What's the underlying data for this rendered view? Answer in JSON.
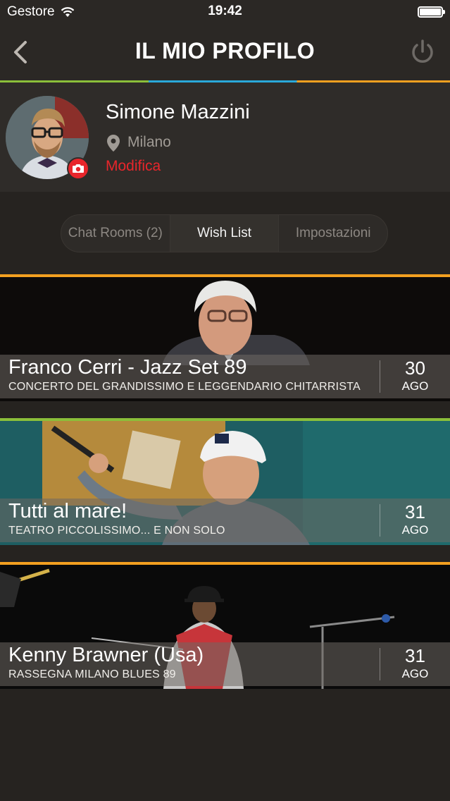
{
  "status_bar": {
    "carrier": "Gestore",
    "time": "19:42",
    "wifi_icon": "wifi-icon",
    "battery_icon": "battery-icon"
  },
  "nav": {
    "title": "IL MIO PROFILO",
    "back_icon": "chevron-left-icon",
    "power_icon": "power-icon",
    "stripe_colors": [
      "#8bbf3a",
      "#2aa9d9",
      "#f3a020"
    ]
  },
  "profile": {
    "name": "Simone Mazzini",
    "city": "Milano",
    "edit_label": "Modifica",
    "accent_color": "#e8262b"
  },
  "tabs": [
    {
      "label": "Chat Rooms (2)",
      "active": false
    },
    {
      "label": "Wish List",
      "active": true
    },
    {
      "label": "Impostazioni",
      "active": false
    }
  ],
  "events": [
    {
      "title": "Franco Cerri - Jazz Set 89",
      "subtitle": "CONCERTO DEL GRANDISSIMO E LEGGENDARIO CHITARRISTA",
      "day": "30",
      "month": "AGO",
      "stripe_color": "#f3a020"
    },
    {
      "title": "Tutti al mare!",
      "subtitle": "TEATRO PICCOLISSIMO... E NON SOLO",
      "day": "31",
      "month": "AGO",
      "stripe_color": "#8bbf3a"
    },
    {
      "title": "Kenny Brawner (Usa)",
      "subtitle": "RASSEGNA MILANO BLUES 89",
      "day": "31",
      "month": "AGO",
      "stripe_color": "#f3a020"
    }
  ]
}
